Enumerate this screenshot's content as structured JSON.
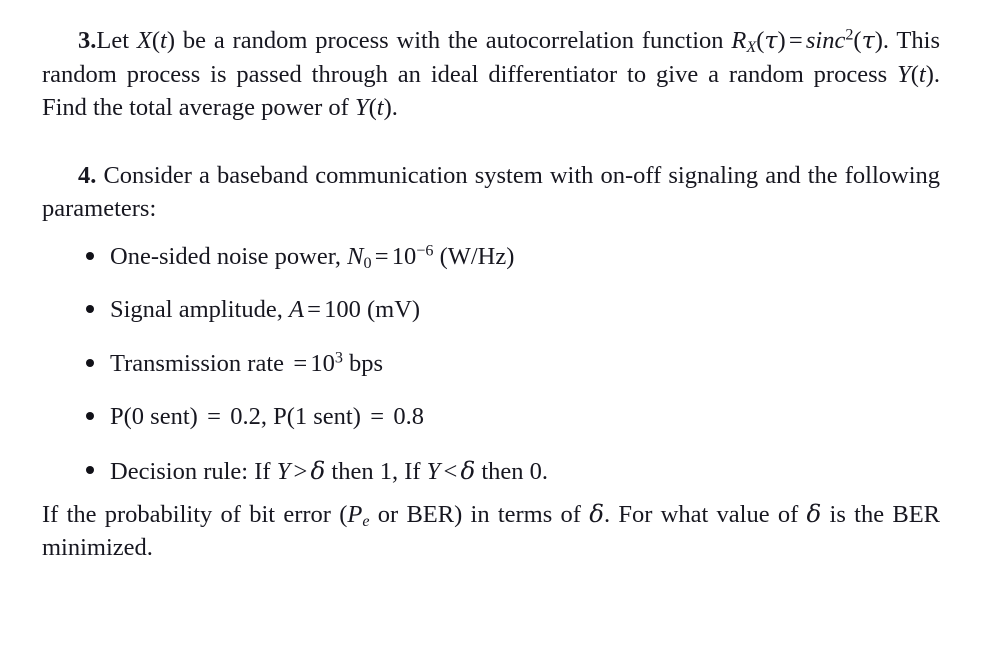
{
  "document": {
    "type": "homework-problem-sheet",
    "background_color": "#ffffff",
    "text_color": "#171720"
  },
  "problem3": {
    "number": "3.",
    "seg_a": "Let ",
    "var_X": "X",
    "paren_t_1": "(",
    "var_t_1": "t",
    "paren_t_2": ")",
    "seg_b": " be a random process with the autocorrelation function ",
    "R": "R",
    "R_sub": "X",
    "R_open": "(",
    "tau1": "τ",
    "R_close": ")",
    "equals1": "=",
    "sinc": "sinc",
    "sinc_sup": "2",
    "sinc_open": "(",
    "tau2": "τ",
    "sinc_close": ")",
    "seg_c": ". This random process is passed through an ideal differentiator to give a random process ",
    "var_Y1": "Y",
    "Y1_open": "(",
    "Y1_t": "t",
    "Y1_close": ")",
    "seg_d": ". Find the total average power of ",
    "var_Y2": "Y",
    "Y2_open": "(",
    "Y2_t": "t",
    "Y2_close": ")",
    "seg_e": "."
  },
  "problem4": {
    "number": "4.",
    "intro": "Consider a baseband communication system with on-off signaling and the following parameters:",
    "bullets": [
      {
        "id": "noise-power",
        "pre": "One-sided noise power, ",
        "sym": "N",
        "sym_sub": "0",
        "eq": "=",
        "base": "10",
        "exp": "−6",
        "post": "(W/Hz)"
      },
      {
        "id": "signal-amplitude",
        "pre": "Signal amplitude, ",
        "sym": "A",
        "eq": "=",
        "base": "100",
        "post": "(mV)"
      },
      {
        "id": "transmission-rate",
        "pre": "Transmission rate ",
        "eq": "=",
        "base": "10",
        "exp": "3",
        "post": "bps"
      },
      {
        "id": "priors",
        "text_a": "P(0 sent) ",
        "eq_a": "=",
        "val_a": " 0.2, P(1 sent) ",
        "eq_b": "=",
        "val_b": " 0.8"
      },
      {
        "id": "decision-rule",
        "pre": "Decision rule: If ",
        "y1": "Y",
        "gt": ">",
        "d1": "δ",
        "mid": " then 1, If ",
        "y2": "Y",
        "lt": "<",
        "d2": "δ",
        "post": " then 0."
      }
    ],
    "closing": {
      "seg_a": "If the probability of bit error (",
      "P": "P",
      "P_sub": "e",
      "seg_b": " or BER) in terms of ",
      "delta1": "δ",
      "seg_c": ". For what value of ",
      "delta2": "δ",
      "seg_d": " is the BER minimized."
    }
  }
}
